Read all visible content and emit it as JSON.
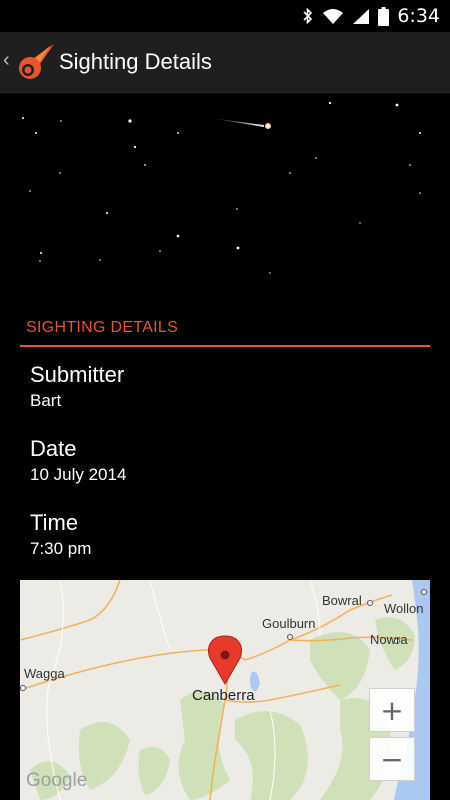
{
  "status_bar": {
    "time": "6:34"
  },
  "action_bar": {
    "title": "Sighting Details",
    "up_icon": "chevron-left-icon",
    "logo_icon": "meteor-logo-icon"
  },
  "section": {
    "header": "SIGHTING DETAILS"
  },
  "fields": {
    "submitter": {
      "label": "Submitter",
      "value": "Bart"
    },
    "date": {
      "label": "Date",
      "value": "10 July 2014"
    },
    "time": {
      "label": "Time",
      "value": "7:30 pm"
    }
  },
  "map": {
    "labels": {
      "canberra": "Canberra",
      "goulburn": "Goulburn",
      "bowral": "Bowral",
      "wollongong": "Wollon",
      "nowra": "Nowra",
      "wagga": "Wagga"
    },
    "zoom_in": "+",
    "zoom_out": "−",
    "attribution": "Google"
  },
  "colors": {
    "accent": "#e8562a",
    "action_bar": "#1f1f1f",
    "background": "#000000"
  }
}
